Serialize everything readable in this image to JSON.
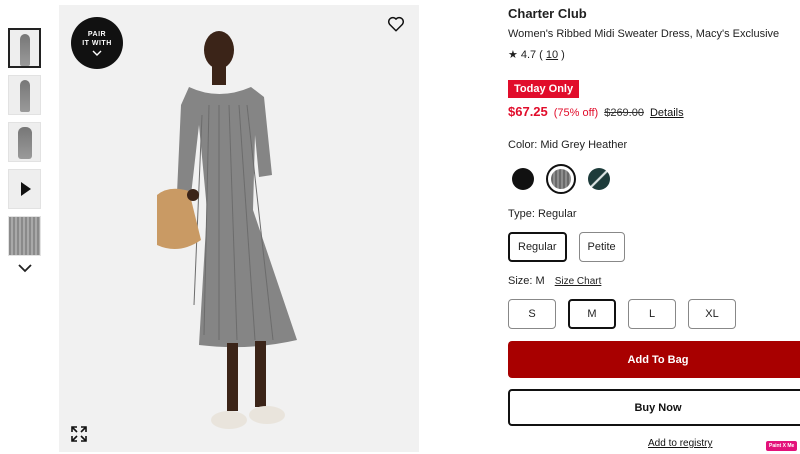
{
  "gallery": {
    "thumbnails": [
      {
        "label": "front-view",
        "active": true
      },
      {
        "label": "side-view",
        "active": false
      },
      {
        "label": "flat-view",
        "active": false
      },
      {
        "label": "video",
        "active": false
      },
      {
        "label": "fabric-detail",
        "active": false
      }
    ],
    "pair_badge": {
      "line1": "PAIR",
      "line2": "IT WITH"
    },
    "icons": [
      "chevron-down-icon",
      "heart-icon",
      "expand-icon",
      "play-icon"
    ]
  },
  "product": {
    "brand": "Charter Club",
    "name": "Women's Ribbed Midi Sweater Dress, Macy's Exclusive",
    "rating_value": "4.7",
    "review_count": "10",
    "badge": "Today Only",
    "sale_price": "$67.25",
    "discount": "(75% off)",
    "original_price": "$269.00",
    "details_link": "Details"
  },
  "color": {
    "label": "Color: Mid Grey Heather",
    "swatches": [
      {
        "name": "black",
        "color": "#111111",
        "selected": false
      },
      {
        "name": "mid-grey-heather",
        "color": "#7a7a7a",
        "selected": true
      },
      {
        "name": "dark-green-stripe",
        "color": "#1d3b3a",
        "selected": false
      }
    ]
  },
  "type": {
    "label": "Type: Regular",
    "options": [
      {
        "label": "Regular",
        "selected": true
      },
      {
        "label": "Petite",
        "selected": false
      }
    ]
  },
  "size": {
    "label": "Size: M",
    "chart_link": "Size Chart",
    "options": [
      {
        "label": "S",
        "selected": false
      },
      {
        "label": "M",
        "selected": true
      },
      {
        "label": "L",
        "selected": false
      },
      {
        "label": "XL",
        "selected": false
      }
    ]
  },
  "actions": {
    "add_to_bag": "Add To Bag",
    "buy_now": "Buy Now",
    "registry": "Add to registry"
  },
  "extension_badge": "Paint X Me",
  "colors": {
    "accent_red": "#e10d2b",
    "bag_button": "#a80000"
  }
}
